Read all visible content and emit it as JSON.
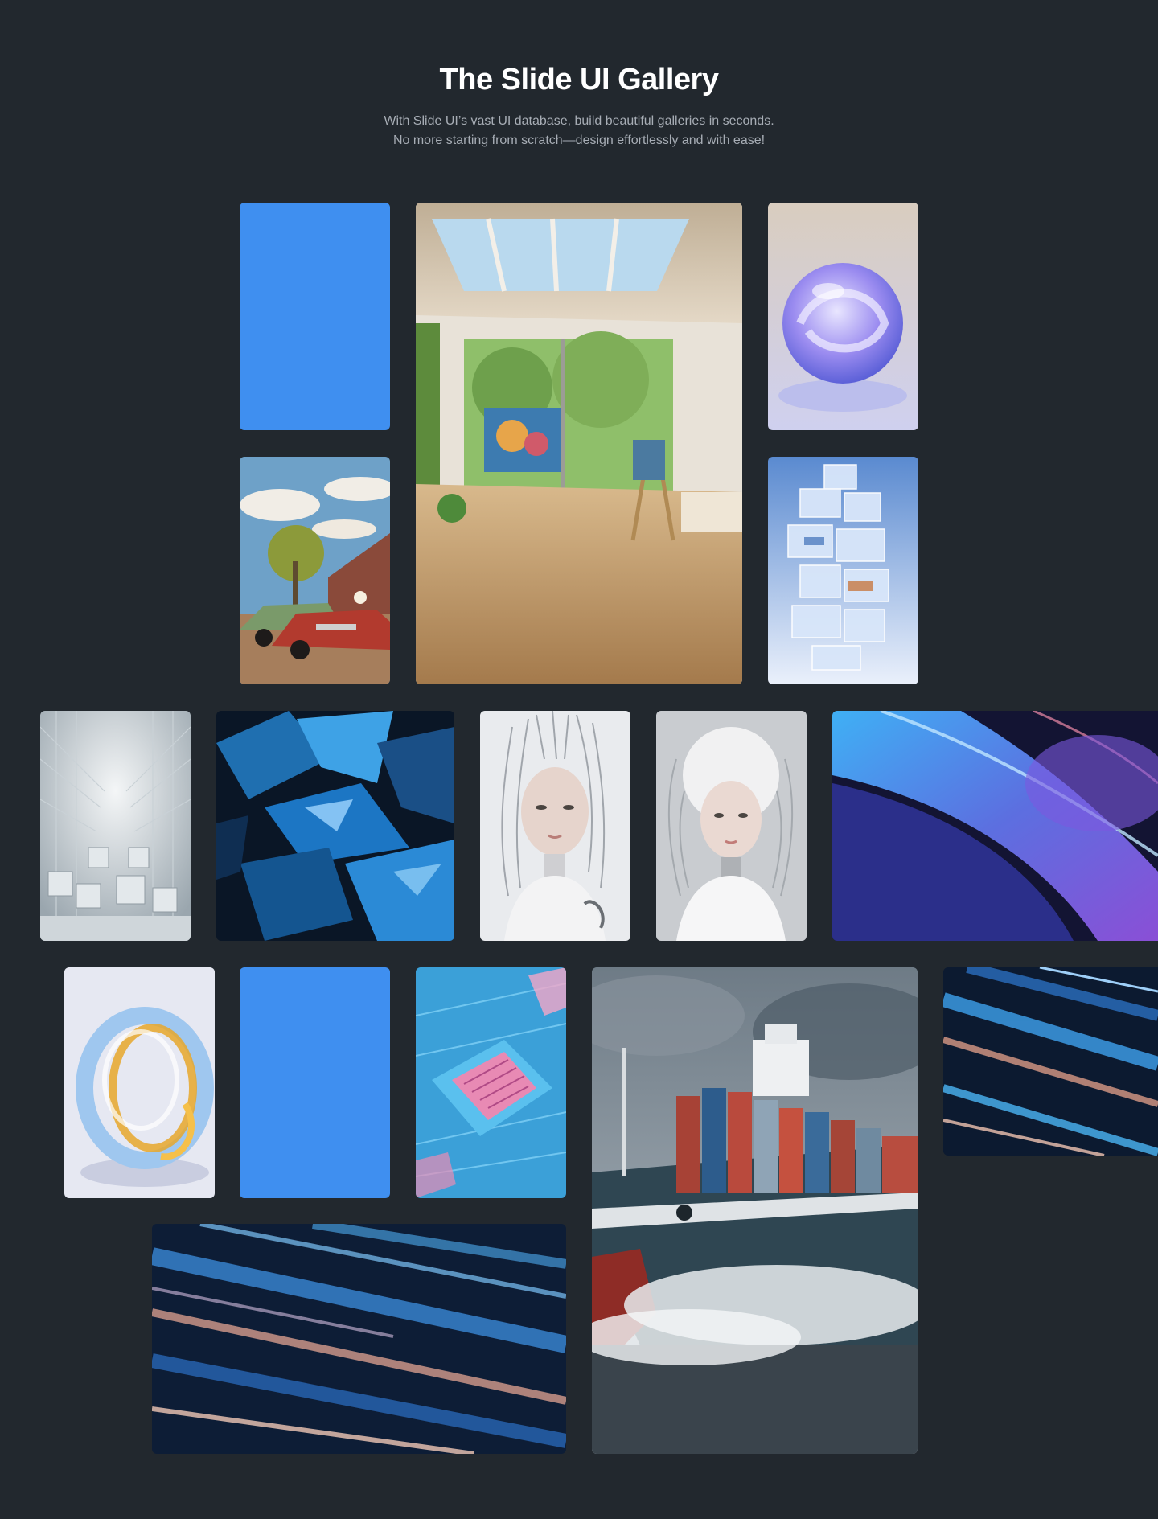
{
  "page": {
    "title": "The Slide UI Gallery",
    "subtitle_line1": "With Slide UI’s vast UI database, build beautiful galleries in seconds.",
    "subtitle_line2": "No more starting from scratch—design effortlessly and with ease!"
  },
  "colors": {
    "background": "#22282e",
    "accent_blue": "#3f8ff0"
  },
  "gallery": {
    "tiles": [
      {
        "name": "blue-placeholder-tile",
        "kind": "solid-blue"
      },
      {
        "name": "art-studio-image",
        "kind": "photo"
      },
      {
        "name": "glass-sphere-image",
        "kind": "photo"
      },
      {
        "name": "vintage-cars-image",
        "kind": "photo"
      },
      {
        "name": "glass-cube-tower-image",
        "kind": "photo"
      },
      {
        "name": "white-maze-city-image",
        "kind": "photo"
      },
      {
        "name": "blue-shards-image",
        "kind": "photo"
      },
      {
        "name": "android-woman-1-image",
        "kind": "photo"
      },
      {
        "name": "android-woman-2-image",
        "kind": "photo"
      },
      {
        "name": "blue-wave-abstract-image",
        "kind": "photo"
      },
      {
        "name": "glass-ring-image",
        "kind": "photo"
      },
      {
        "name": "blue-placeholder-tile",
        "kind": "solid-blue"
      },
      {
        "name": "circuit-chip-image",
        "kind": "photo"
      },
      {
        "name": "cargo-ship-image",
        "kind": "photo"
      },
      {
        "name": "metallic-streaks-image",
        "kind": "photo"
      },
      {
        "name": "metallic-streaks-wide-image",
        "kind": "photo"
      }
    ]
  }
}
